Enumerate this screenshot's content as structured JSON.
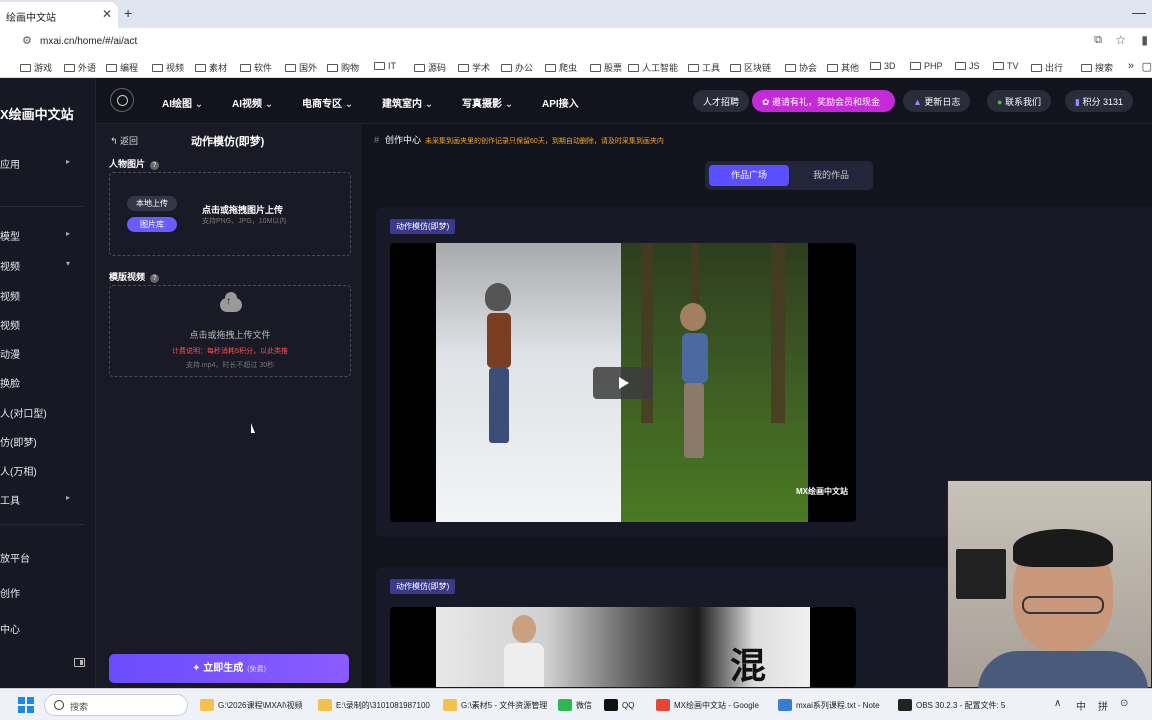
{
  "browser": {
    "tab_title": "绘画中文站",
    "tab_close": "✕",
    "new_tab": "+",
    "minimize": "—",
    "url": "mxai.cn/home/#/ai/act",
    "bookmarks": [
      "游戏",
      "外语",
      "编程",
      "视频",
      "素材",
      "软件",
      "国外",
      "购物",
      "IT",
      "源码",
      "学术",
      "办公",
      "爬虫",
      "股票",
      "人工智能",
      "工具",
      "区块链",
      "协会",
      "其他",
      "3D",
      "PHP",
      "JS",
      "TV",
      "出行",
      "搜索"
    ],
    "more": "»",
    "last": "▢"
  },
  "sidebar": {
    "logo": "X绘画中文站",
    "items": [
      "应用",
      "模型",
      "视频",
      "视频",
      "视频",
      "动漫",
      "换脸",
      "人(对口型)",
      "仿(即梦)",
      "人(万相)",
      "工具",
      "放平台",
      "创作",
      "中心"
    ]
  },
  "topnav": {
    "items": [
      "AI绘图",
      "AI视频",
      "电商专区",
      "建筑室内",
      "写真摄影",
      "API接入"
    ],
    "talent": "人才招聘",
    "invite": "邀请有礼，奖励会员和现金",
    "changelog": "更新日志",
    "contact": "联系我们",
    "points": "积分 3131"
  },
  "panel": {
    "back": "返回",
    "title": "动作模仿(即梦)",
    "person_label": "人物图片",
    "local_upload": "本地上传",
    "gallery": "图片库",
    "upload_title": "点击或拖拽图片上传",
    "upload_sub": "支持PNG、JPG，10M以内",
    "template_label": "模版视频",
    "video_title": "点击或拖拽上传文件",
    "video_cost": "计费说明：每秒消耗5积分，以此类推",
    "video_sub": "支持.mp4，时长不超过 30秒",
    "generate": "立即生成",
    "free": "(免费)",
    "help": "?"
  },
  "main": {
    "crumb": "创作中心",
    "crumb_note": "未采集到画夹里的创作记录只保留60天，到期自动删除，请及时采集到画夹内",
    "tab_plaza": "作品广场",
    "tab_mine": "我的作品",
    "card_tag": "动作模仿(即梦)",
    "watermark": "MX绘画中文站",
    "ink_char": "混"
  },
  "taskbar": {
    "search": "搜索",
    "apps": [
      "G:\\2026课程\\MXAI\\视频",
      "E:\\录制的\\3101081987100",
      "G:\\素材5 - 文件资源管理",
      "微信",
      "QQ",
      "MX绘画中文站 - Google",
      "mxai系列课程.txt - Note",
      "OBS 30.2.3 - 配置文件: 5"
    ],
    "tray": [
      "∧",
      "中",
      "拼",
      "⊙"
    ]
  }
}
